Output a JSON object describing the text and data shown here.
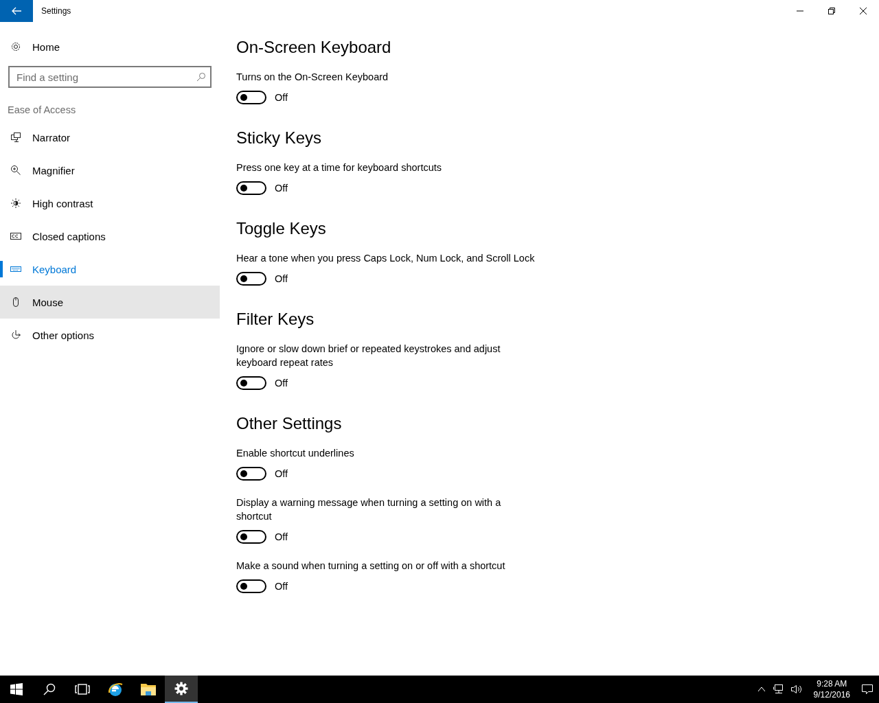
{
  "window": {
    "title": "Settings"
  },
  "sidebar": {
    "home": {
      "label": "Home"
    },
    "search": {
      "placeholder": "Find a setting"
    },
    "group_title": "Ease of Access",
    "items": [
      {
        "label": "Narrator",
        "selected": false,
        "highlighted": false
      },
      {
        "label": "Magnifier",
        "selected": false,
        "highlighted": false
      },
      {
        "label": "High contrast",
        "selected": false,
        "highlighted": false
      },
      {
        "label": "Closed captions",
        "selected": false,
        "highlighted": false
      },
      {
        "label": "Keyboard",
        "selected": true,
        "highlighted": false
      },
      {
        "label": "Mouse",
        "selected": false,
        "highlighted": true
      },
      {
        "label": "Other options",
        "selected": false,
        "highlighted": false
      }
    ]
  },
  "sections": [
    {
      "title": "On-Screen Keyboard",
      "settings": [
        {
          "description": "Turns on the On-Screen Keyboard",
          "on": false,
          "state_label": "Off"
        }
      ]
    },
    {
      "title": "Sticky Keys",
      "settings": [
        {
          "description": "Press one key at a time for keyboard shortcuts",
          "on": false,
          "state_label": "Off"
        }
      ]
    },
    {
      "title": "Toggle Keys",
      "settings": [
        {
          "description": "Hear a tone when you press Caps Lock, Num Lock, and Scroll Lock",
          "on": false,
          "state_label": "Off"
        }
      ]
    },
    {
      "title": "Filter Keys",
      "settings": [
        {
          "description": "Ignore or slow down brief or repeated keystrokes and adjust keyboard repeat rates",
          "on": false,
          "state_label": "Off"
        }
      ]
    },
    {
      "title": "Other Settings",
      "settings": [
        {
          "description": "Enable shortcut underlines",
          "on": false,
          "state_label": "Off"
        },
        {
          "description": "Display a warning message when turning a setting on with a shortcut",
          "on": false,
          "state_label": "Off"
        },
        {
          "description": "Make a sound when turning a setting on or off with a shortcut",
          "on": false,
          "state_label": "Off"
        }
      ]
    }
  ],
  "taskbar": {
    "items": [
      {
        "active": false
      },
      {
        "active": false
      },
      {
        "active": false
      },
      {
        "active": false
      },
      {
        "active": false
      },
      {
        "active": true
      }
    ],
    "time": "9:28 AM",
    "date": "9/12/2016"
  }
}
